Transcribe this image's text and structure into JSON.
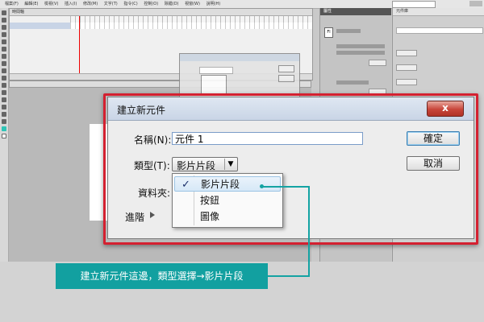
{
  "app": {
    "menu_items": [
      "檔案(F)",
      "編輯(E)",
      "檢視(V)",
      "插入(I)",
      "修改(M)",
      "文字(T)",
      "指令(C)",
      "控制(O)",
      "除錯(D)",
      "視窗(W)",
      "說明(H)"
    ],
    "timeline_tab": "時間軸",
    "properties_tab": "屬性",
    "library_tab": "元件庫"
  },
  "dialog": {
    "title": "建立新元件",
    "close_label": "x",
    "name_label": "名稱(N):",
    "name_value": "元件 1",
    "type_label": "類型(T):",
    "type_value": "影片片段",
    "folder_label": "資料夾:",
    "advanced_label": "進階",
    "ok_label": "確定",
    "cancel_label": "取消"
  },
  "dropdown": {
    "items": [
      {
        "label": "影片片段",
        "selected": true
      },
      {
        "label": "按鈕",
        "selected": false
      },
      {
        "label": "圖像",
        "selected": false
      }
    ],
    "check": "✓"
  },
  "callout": {
    "text": "建立新元件這邊，類型選擇→影片片段",
    "color": "#12a0a0"
  },
  "colors": {
    "highlight_border": "#d42030",
    "close_button": "#c8453a"
  }
}
